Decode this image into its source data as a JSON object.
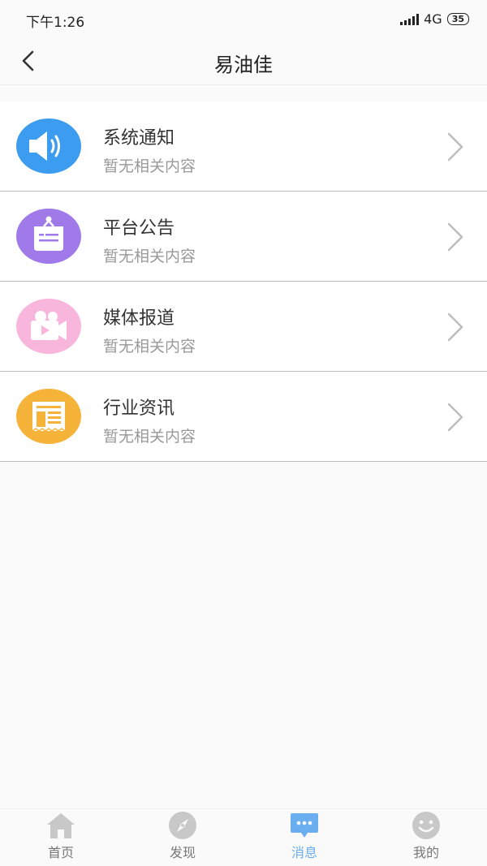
{
  "status": {
    "time": "下午1:26",
    "network": "4G",
    "battery": "35"
  },
  "header": {
    "title": "易油佳"
  },
  "items": [
    {
      "title": "系统通知",
      "subtitle": "暂无相关内容",
      "icon": "speaker-icon",
      "color": "#3b9cf0"
    },
    {
      "title": "平台公告",
      "subtitle": "暂无相关内容",
      "icon": "notice-board-icon",
      "color": "#9f7ae8"
    },
    {
      "title": "媒体报道",
      "subtitle": "暂无相关内容",
      "icon": "video-camera-icon",
      "color": "#f9b6dd"
    },
    {
      "title": "行业资讯",
      "subtitle": "暂无相关内容",
      "icon": "newspaper-icon",
      "color": "#f6b33a"
    }
  ],
  "tabs": [
    {
      "label": "首页",
      "icon": "home-icon"
    },
    {
      "label": "发现",
      "icon": "compass-icon"
    },
    {
      "label": "消息",
      "icon": "message-icon",
      "active": true
    },
    {
      "label": "我的",
      "icon": "smiley-icon"
    }
  ],
  "colors": {
    "active_tab": "#6aaef0",
    "inactive_tab": "#c8c8c8"
  }
}
